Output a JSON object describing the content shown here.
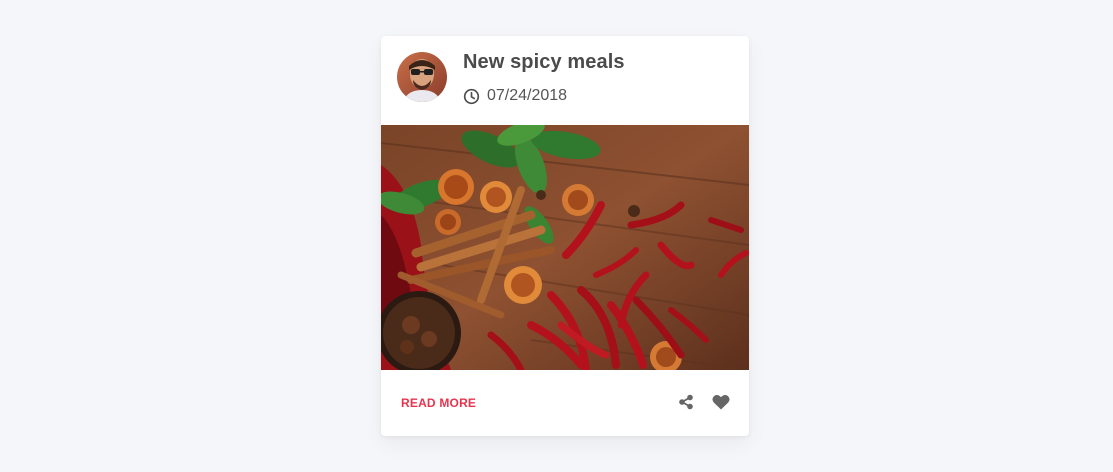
{
  "card": {
    "title": "New spicy meals",
    "date": "07/24/2018",
    "read_more_label": "READ MORE"
  },
  "icons": {
    "avatar": "user-avatar-photo",
    "date": "clock-icon",
    "share": "share-icon",
    "like": "heart-icon"
  },
  "colors": {
    "page_background": "#f5f6fa",
    "card_background": "#ffffff",
    "title": "#4b4b4b",
    "date_text": "#555555",
    "accent": "#e8344e",
    "action_icons": "#666666"
  }
}
